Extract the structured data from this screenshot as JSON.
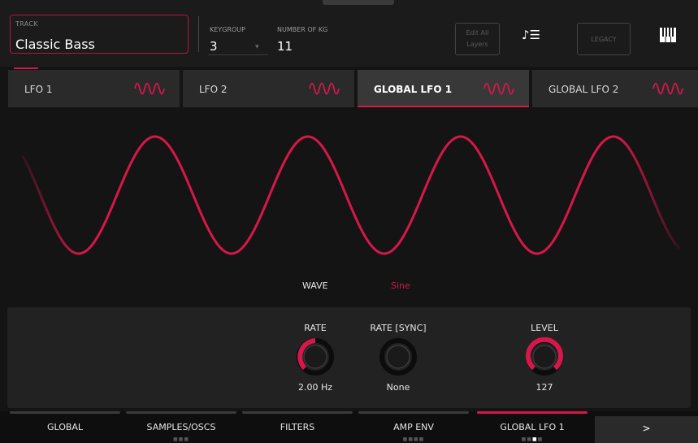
{
  "header": {
    "track_label": "TRACK",
    "track_name": "Classic Bass",
    "keygroup_label": "KEYGROUP",
    "keygroup_value": "3",
    "num_kg_label": "NUMBER OF KG",
    "num_kg_value": "11",
    "edit_layers_line1": "Edit All",
    "edit_layers_line2": "Layers",
    "legacy_label": "LEGACY"
  },
  "tabs": [
    {
      "label": "LFO 1",
      "active": false
    },
    {
      "label": "LFO 2",
      "active": false
    },
    {
      "label": "GLOBAL LFO 1",
      "active": true
    },
    {
      "label": "GLOBAL LFO 2",
      "active": false
    }
  ],
  "waveform": {
    "wave_label": "WAVE",
    "wave_value": "Sine"
  },
  "knobs": {
    "rate": {
      "title": "RATE",
      "value": "2.00 Hz"
    },
    "rate_sync": {
      "title": "RATE  [SYNC]",
      "value": "None"
    },
    "level": {
      "title": "LEVEL",
      "value": "127"
    }
  },
  "bottom_nav": {
    "items": [
      {
        "label": "GLOBAL",
        "active": false
      },
      {
        "label": "SAMPLES/OSCS",
        "active": false
      },
      {
        "label": "FILTERS",
        "active": false
      },
      {
        "label": "AMP ENV",
        "active": false
      },
      {
        "label": "GLOBAL LFO 1",
        "active": true
      }
    ],
    "next_label": ">"
  },
  "colors": {
    "accent": "#d6174a",
    "background": "#141414",
    "panel": "#222222"
  },
  "icons": {
    "wave_tab": "sine-wave-icon",
    "sequence_list": "note-list-icon",
    "keyboard": "piano-keys-icon"
  }
}
